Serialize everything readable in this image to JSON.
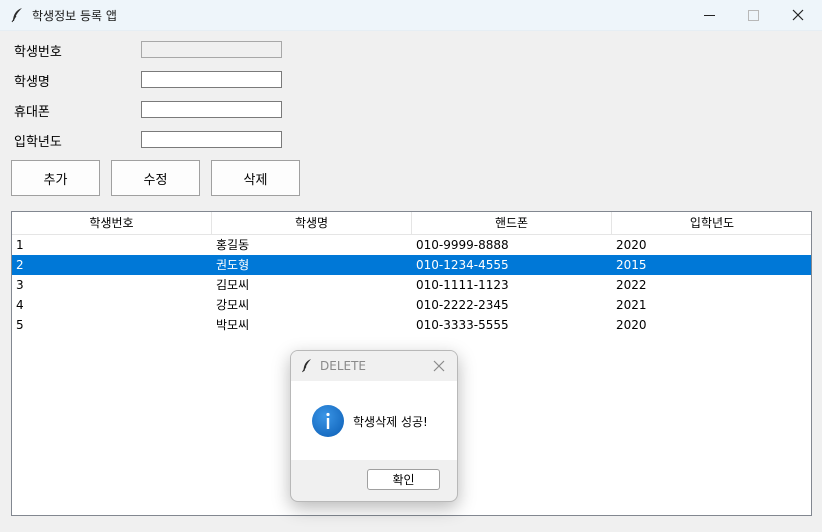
{
  "window": {
    "title": "학생정보 등록 앱",
    "controls": {
      "minimize": "minimize-icon",
      "maximize": "maximize-icon",
      "close": "close-icon"
    }
  },
  "form": {
    "fields": [
      {
        "label": "학생번호",
        "value": "",
        "disabled": true
      },
      {
        "label": "학생명",
        "value": ""
      },
      {
        "label": "휴대폰",
        "value": ""
      },
      {
        "label": "입학년도",
        "value": ""
      }
    ]
  },
  "buttons": {
    "add": "추가",
    "edit": "수정",
    "delete": "삭제"
  },
  "table": {
    "columns": [
      "학생번호",
      "학생명",
      "핸드폰",
      "입학년도"
    ],
    "rows": [
      [
        "1",
        "홍길동",
        "010-9999-8888",
        "2020"
      ],
      [
        "2",
        "권도형",
        "010-1234-4555",
        "2015"
      ],
      [
        "3",
        "김모씨",
        "010-1111-1123",
        "2022"
      ],
      [
        "4",
        "강모씨",
        "010-2222-2345",
        "2021"
      ],
      [
        "5",
        "박모씨",
        "010-3333-5555",
        "2020"
      ]
    ],
    "selected_row": "2"
  },
  "dialog": {
    "title": "DELETE",
    "message": "학생삭제 성공!",
    "ok_label": "확인",
    "icon": "info-icon"
  },
  "colors": {
    "selection": "#0078d7",
    "titlebar": "#eef5fa",
    "info": "#1a73c8"
  }
}
